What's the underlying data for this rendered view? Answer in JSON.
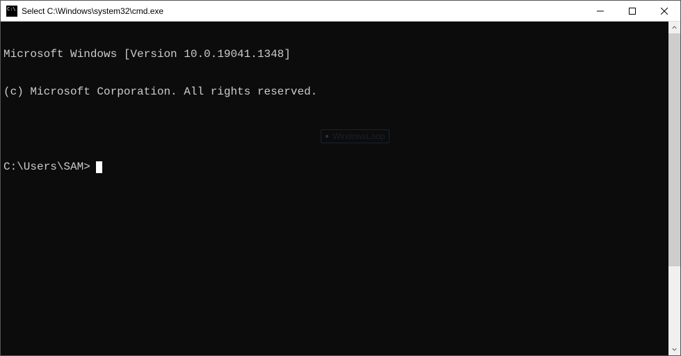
{
  "window": {
    "title": "Select C:\\Windows\\system32\\cmd.exe"
  },
  "terminal": {
    "line1": "Microsoft Windows [Version 10.0.19041.1348]",
    "line2": "(c) Microsoft Corporation. All rights reserved.",
    "blank": "",
    "prompt": "C:\\Users\\SAM>"
  },
  "watermark": {
    "text": "WindowsLoop"
  }
}
